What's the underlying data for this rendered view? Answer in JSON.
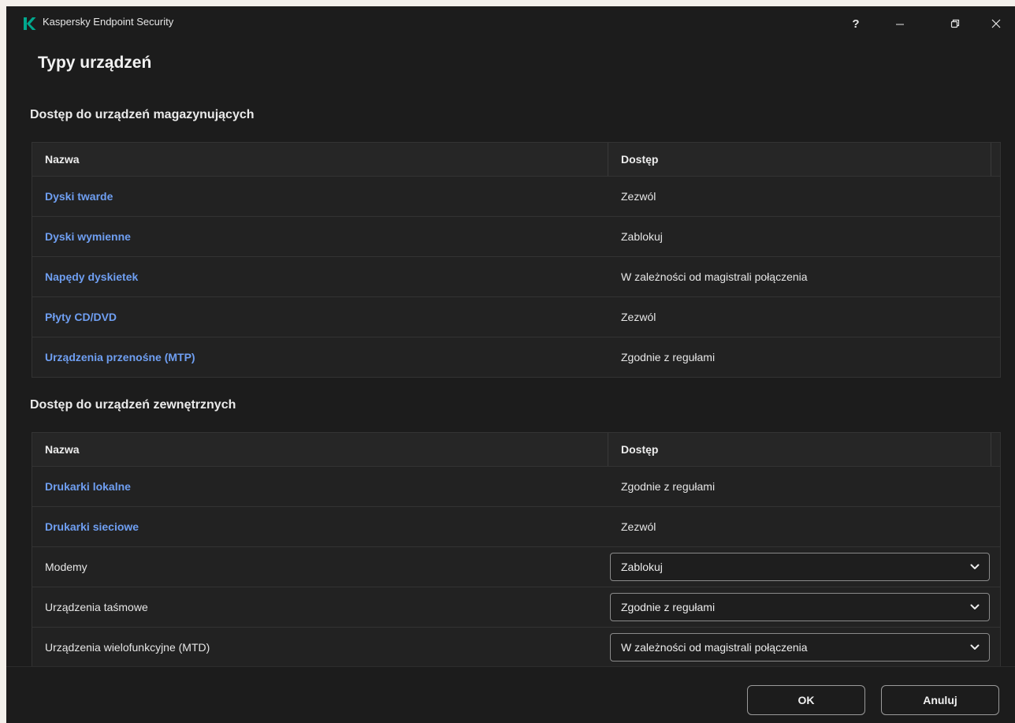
{
  "window": {
    "app_title": "Kaspersky Endpoint Security",
    "help_label": "?"
  },
  "page": {
    "title": "Typy urządzeń"
  },
  "storage_section": {
    "title": "Dostęp do urządzeń magazynujących",
    "columns": {
      "name": "Nazwa",
      "access": "Dostęp"
    },
    "rows": [
      {
        "name": "Dyski twarde",
        "access": "Zezwól"
      },
      {
        "name": "Dyski wymienne",
        "access": "Zablokuj"
      },
      {
        "name": "Napędy dyskietek",
        "access": "W zależności od magistrali połączenia"
      },
      {
        "name": "Płyty CD/DVD",
        "access": "Zezwól"
      },
      {
        "name": "Urządzenia przenośne (MTP)",
        "access": "Zgodnie z regułami"
      }
    ]
  },
  "external_section": {
    "title": "Dostęp do urządzeń zewnętrznych",
    "columns": {
      "name": "Nazwa",
      "access": "Dostęp"
    },
    "rows": [
      {
        "name": "Drukarki lokalne",
        "access": "Zgodnie z regułami"
      },
      {
        "name": "Drukarki sieciowe",
        "access": "Zezwól"
      },
      {
        "name": "Modemy",
        "access": "Zablokuj"
      },
      {
        "name": "Urządzenia taśmowe",
        "access": "Zgodnie z regułami"
      },
      {
        "name": "Urządzenia wielofunkcyjne (MTD)",
        "access": "W zależności od magistrali połączenia"
      }
    ]
  },
  "footer": {
    "ok_label": "OK",
    "cancel_label": "Anuluj"
  },
  "colors": {
    "background": "#1c1c1c",
    "link": "#6f9ff2",
    "logo": "#00a88e"
  }
}
